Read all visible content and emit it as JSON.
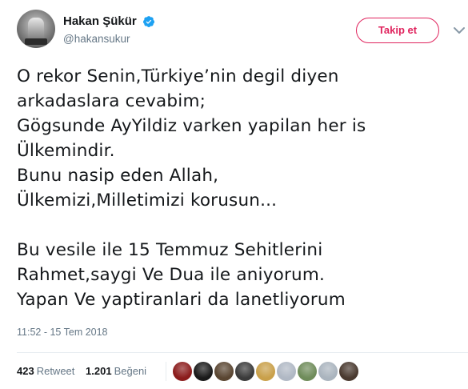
{
  "user": {
    "display_name": "Hakan Şükür",
    "handle": "@hakansukur",
    "verified": true,
    "avatar_icon": "trophy-avatar"
  },
  "follow_button": {
    "label": "Takip et",
    "color": "#e0245e"
  },
  "tweet": {
    "lines": [
      "O rekor Senin,Türkiye’nin degil diyen",
      "arkadaslara cevabim;",
      "Gögsunde AyYildiz varken yapilan her is",
      "Ülkemindir.",
      "Bunu nasip eden Allah,",
      "Ülkemizi,Milletimizi korusun...",
      "",
      "Bu vesile ile 15 Temmuz Sehitlerini",
      "Rahmet,saygi Ve Dua ile aniyorum.",
      "Yapan Ve yaptiranlari da lanetliyorum"
    ],
    "timestamp": "11:52 - 15 Tem 2018"
  },
  "stats": {
    "retweets_count": "423",
    "retweets_label": "Retweet",
    "likes_count": "1.201",
    "likes_label": "Beğeni"
  },
  "likers": [
    {
      "name": "liker-avatar-1",
      "color": "#8b1c1c"
    },
    {
      "name": "liker-avatar-2",
      "color": "#1a1a1a"
    },
    {
      "name": "liker-avatar-3",
      "color": "#5a4632"
    },
    {
      "name": "liker-avatar-4",
      "color": "#3b3b3b"
    },
    {
      "name": "liker-avatar-5",
      "color": "#c9a04a"
    },
    {
      "name": "liker-avatar-6",
      "color": "#b0b8c4"
    },
    {
      "name": "liker-avatar-7",
      "color": "#6f8c5a"
    },
    {
      "name": "liker-avatar-8",
      "color": "#aab4be"
    },
    {
      "name": "liker-avatar-9",
      "color": "#4a3a30"
    }
  ],
  "colors": {
    "text": "#14171a",
    "secondary": "#657786",
    "verified": "#1da1f2",
    "divider": "#e6ecf0"
  }
}
